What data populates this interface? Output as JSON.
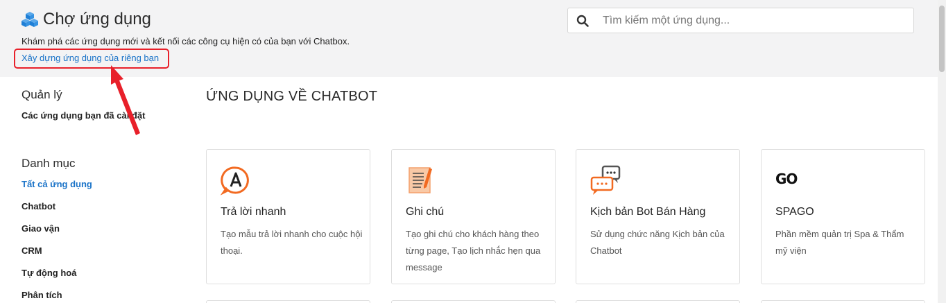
{
  "header": {
    "title": "Chợ ứng dụng",
    "subtitle": "Khám phá các ứng dụng mới và kết nối các công cụ hiện có của bạn với Chatbox.",
    "build_link": "Xây dựng ứng dụng của riêng bạn"
  },
  "search": {
    "placeholder": "Tìm kiếm một ứng dụng..."
  },
  "sidebar": {
    "manage_heading": "Quản lý",
    "manage_items": [
      {
        "label": "Các ứng dụng bạn đã cài đặt"
      }
    ],
    "category_heading": "Danh mục",
    "categories": [
      {
        "label": "Tất cả ứng dụng",
        "active": true
      },
      {
        "label": "Chatbot"
      },
      {
        "label": "Giao vận"
      },
      {
        "label": "CRM"
      },
      {
        "label": "Tự động hoá"
      },
      {
        "label": "Phân tích"
      }
    ]
  },
  "main": {
    "section_title": "ỨNG DỤNG VỀ CHATBOT",
    "apps": [
      {
        "name": "Trả lời nhanh",
        "description": "Tạo mẫu trả lời nhanh cho cuộc hội thoại.",
        "icon": "quick-reply-icon"
      },
      {
        "name": "Ghi chú",
        "description": "Tạo ghi chú cho khách hàng theo từng page, Tạo lịch nhắc hẹn qua message",
        "icon": "note-icon"
      },
      {
        "name": "Kịch bản Bot Bán Hàng",
        "description": "Sử dụng chức năng Kịch bản của Chatbot",
        "icon": "chat-bubbles-icon"
      },
      {
        "name": "SPAGO",
        "description": "Phần mềm quản trị Spa & Thẩm mỹ viện",
        "icon": "spago-logo-icon",
        "logo_text": "GO"
      }
    ]
  },
  "colors": {
    "accent": "#1a73c8",
    "highlight": "#e8202a",
    "icon_orange": "#f26a21"
  }
}
